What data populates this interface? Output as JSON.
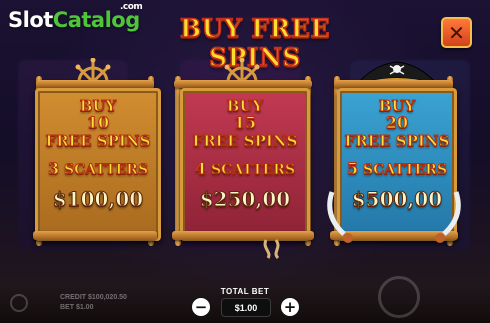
{
  "logo": {
    "slot": "Slot",
    "catalog": "Catalog",
    "com": ".com"
  },
  "title": "BUY FREE SPINS",
  "close_glyph": "✕",
  "cards": [
    {
      "buy": "BUY",
      "spins": "10",
      "free_spins": "FREE SPINS",
      "scatters_count": "3",
      "scatters_label": "SCATTERS",
      "price": "$100,00",
      "color": "#c17f2a"
    },
    {
      "buy": "BUY",
      "spins": "15",
      "free_spins": "FREE SPINS",
      "scatters_count": "4",
      "scatters_label": "SCATTERS",
      "price": "$250,00",
      "color": "#b23248"
    },
    {
      "buy": "BUY",
      "spins": "20",
      "free_spins": "FREE SPINS",
      "scatters_count": "5",
      "scatters_label": "SCATTERS",
      "price": "$500,00",
      "color": "#2e8fbf"
    }
  ],
  "total_bet": {
    "label": "TOTAL BET",
    "value": "$1.00",
    "minus": "−",
    "plus": "+"
  },
  "footer": {
    "credit_label": "CREDIT",
    "credit_value": "$100,020.50",
    "bet_label": "BET",
    "bet_value": "$1.00"
  },
  "icons": [
    "ship-wheel-icon",
    "pirate-hat-icon",
    "skull-icon",
    "sword-icon",
    "close-icon",
    "minus-icon",
    "plus-icon",
    "spin-icon",
    "gear-icon"
  ],
  "colors": {
    "title_fill": "#ffdd2a",
    "title_stroke": "#c0301a",
    "card_border": "#d89b3c",
    "logo_green": "#4fc63a"
  }
}
